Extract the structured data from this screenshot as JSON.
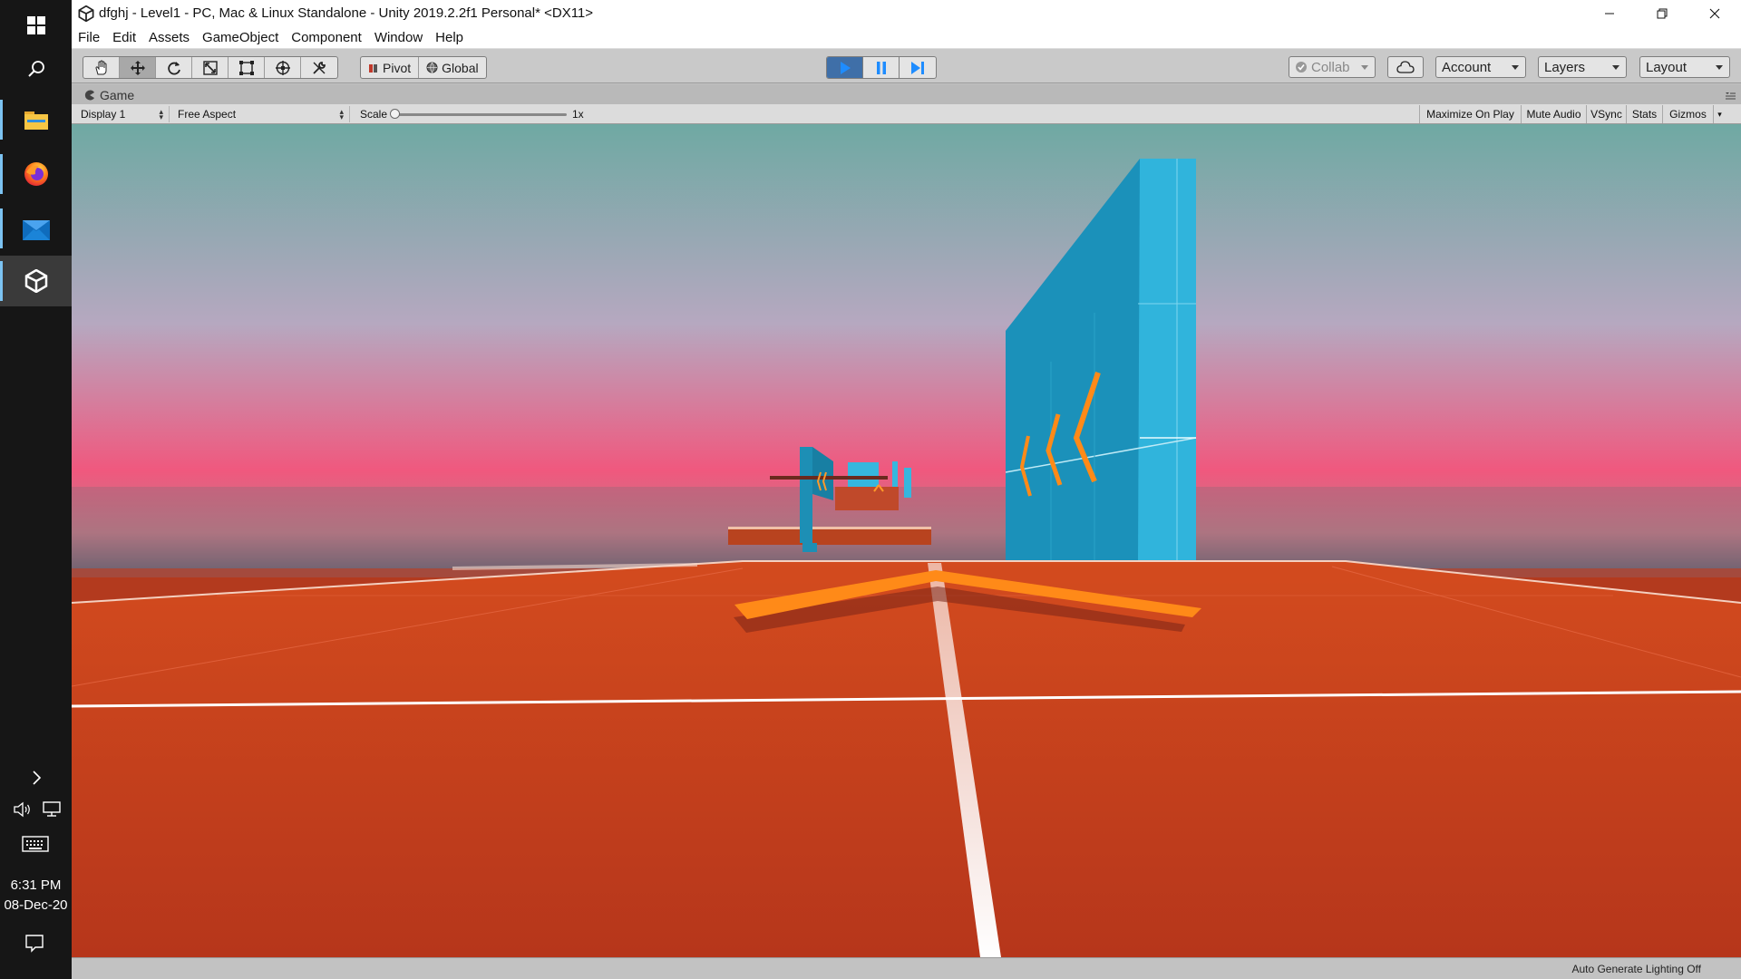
{
  "window": {
    "title": "dfghj - Level1 - PC, Mac & Linux Standalone - Unity 2019.2.2f1 Personal* <DX11>"
  },
  "menu": [
    "File",
    "Edit",
    "Assets",
    "GameObject",
    "Component",
    "Window",
    "Help"
  ],
  "toolbar": {
    "pivot_label": "Pivot",
    "global_label": "Global",
    "collab_label": "Collab",
    "account_label": "Account",
    "layers_label": "Layers",
    "layout_label": "Layout",
    "play_state": "playing"
  },
  "game_view": {
    "tab_label": "Game",
    "display": "Display 1",
    "aspect": "Free Aspect",
    "scale_label": "Scale",
    "scale_value": "1x",
    "toggles": [
      "Maximize On Play",
      "Mute Audio",
      "VSync",
      "Stats",
      "Gizmos"
    ]
  },
  "status": {
    "text": "Auto Generate Lighting Off"
  },
  "taskbar": {
    "time": "6:31 PM",
    "date": "08-Dec-20",
    "apps": [
      "windows-start-icon",
      "search-icon",
      "file-explorer-icon",
      "firefox-icon",
      "mail-icon",
      "unity-icon"
    ]
  },
  "colors": {
    "sky_top": "#6fa9a3",
    "sky_mid": "#b6a8c0",
    "sky_horizon": "#f0587e",
    "floor": "#c03418",
    "wall_blue": "#1f9cc4",
    "arrow_orange": "#ff8a18",
    "unity_toolbar": "#c9c9c9",
    "play_active": "#3f6fa8"
  }
}
